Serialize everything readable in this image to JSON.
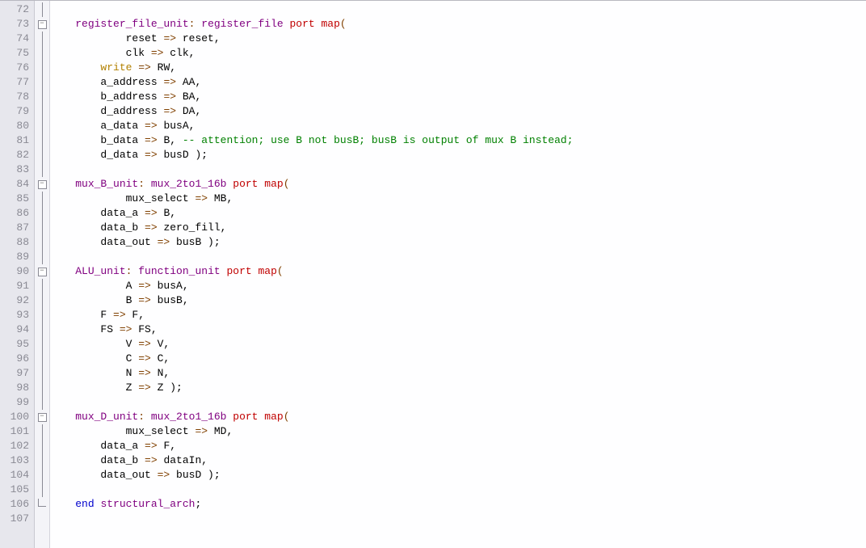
{
  "editor": {
    "first_line_number": 72,
    "lines": [
      {
        "n": 72,
        "fold": "line",
        "tokens": []
      },
      {
        "n": 73,
        "fold": "open",
        "tokens": [
          {
            "c": "t-plain",
            "t": "    "
          },
          {
            "c": "t-label",
            "t": "register_file_unit"
          },
          {
            "c": "t-op",
            "t": ": "
          },
          {
            "c": "t-type",
            "t": "register_file"
          },
          {
            "c": "t-plain",
            "t": " "
          },
          {
            "c": "t-pm",
            "t": "port map"
          },
          {
            "c": "t-op",
            "t": "("
          }
        ]
      },
      {
        "n": 74,
        "fold": "line",
        "tokens": [
          {
            "c": "t-plain",
            "t": "            reset "
          },
          {
            "c": "t-op",
            "t": "=>"
          },
          {
            "c": "t-plain",
            "t": " reset,"
          }
        ]
      },
      {
        "n": 75,
        "fold": "line",
        "tokens": [
          {
            "c": "t-plain",
            "t": "            clk "
          },
          {
            "c": "t-op",
            "t": "=>"
          },
          {
            "c": "t-plain",
            "t": " clk,"
          }
        ]
      },
      {
        "n": 76,
        "fold": "line",
        "tokens": [
          {
            "c": "t-plain",
            "t": "        "
          },
          {
            "c": "t-reskw",
            "t": "write"
          },
          {
            "c": "t-plain",
            "t": " "
          },
          {
            "c": "t-op",
            "t": "=>"
          },
          {
            "c": "t-plain",
            "t": " RW,"
          }
        ]
      },
      {
        "n": 77,
        "fold": "line",
        "tokens": [
          {
            "c": "t-plain",
            "t": "        a_address "
          },
          {
            "c": "t-op",
            "t": "=>"
          },
          {
            "c": "t-plain",
            "t": " AA,"
          }
        ]
      },
      {
        "n": 78,
        "fold": "line",
        "tokens": [
          {
            "c": "t-plain",
            "t": "        b_address "
          },
          {
            "c": "t-op",
            "t": "=>"
          },
          {
            "c": "t-plain",
            "t": " BA,"
          }
        ]
      },
      {
        "n": 79,
        "fold": "line",
        "tokens": [
          {
            "c": "t-plain",
            "t": "        d_address "
          },
          {
            "c": "t-op",
            "t": "=>"
          },
          {
            "c": "t-plain",
            "t": " DA,"
          }
        ]
      },
      {
        "n": 80,
        "fold": "line",
        "tokens": [
          {
            "c": "t-plain",
            "t": "        a_data "
          },
          {
            "c": "t-op",
            "t": "=>"
          },
          {
            "c": "t-plain",
            "t": " busA,"
          }
        ]
      },
      {
        "n": 81,
        "fold": "line",
        "tokens": [
          {
            "c": "t-plain",
            "t": "        b_data "
          },
          {
            "c": "t-op",
            "t": "=>"
          },
          {
            "c": "t-plain",
            "t": " B, "
          },
          {
            "c": "t-cmt",
            "t": "-- attention; use B not busB; busB is output of mux B instead;"
          }
        ]
      },
      {
        "n": 82,
        "fold": "line",
        "tokens": [
          {
            "c": "t-plain",
            "t": "        d_data "
          },
          {
            "c": "t-op",
            "t": "=>"
          },
          {
            "c": "t-plain",
            "t": " busD );"
          }
        ]
      },
      {
        "n": 83,
        "fold": "line",
        "tokens": []
      },
      {
        "n": 84,
        "fold": "open",
        "tokens": [
          {
            "c": "t-plain",
            "t": "    "
          },
          {
            "c": "t-label",
            "t": "mux_B_unit"
          },
          {
            "c": "t-op",
            "t": ": "
          },
          {
            "c": "t-type",
            "t": "mux_2to1_16b"
          },
          {
            "c": "t-plain",
            "t": " "
          },
          {
            "c": "t-pm",
            "t": "port map"
          },
          {
            "c": "t-op",
            "t": "("
          }
        ]
      },
      {
        "n": 85,
        "fold": "line",
        "tokens": [
          {
            "c": "t-plain",
            "t": "            mux_select "
          },
          {
            "c": "t-op",
            "t": "=>"
          },
          {
            "c": "t-plain",
            "t": " MB,"
          }
        ]
      },
      {
        "n": 86,
        "fold": "line",
        "tokens": [
          {
            "c": "t-plain",
            "t": "        data_a "
          },
          {
            "c": "t-op",
            "t": "=>"
          },
          {
            "c": "t-plain",
            "t": " B,"
          }
        ]
      },
      {
        "n": 87,
        "fold": "line",
        "tokens": [
          {
            "c": "t-plain",
            "t": "        data_b "
          },
          {
            "c": "t-op",
            "t": "=>"
          },
          {
            "c": "t-plain",
            "t": " zero_fill,"
          }
        ]
      },
      {
        "n": 88,
        "fold": "line",
        "tokens": [
          {
            "c": "t-plain",
            "t": "        data_out "
          },
          {
            "c": "t-op",
            "t": "=>"
          },
          {
            "c": "t-plain",
            "t": " busB );"
          }
        ]
      },
      {
        "n": 89,
        "fold": "line",
        "tokens": []
      },
      {
        "n": 90,
        "fold": "open",
        "tokens": [
          {
            "c": "t-plain",
            "t": "    "
          },
          {
            "c": "t-label",
            "t": "ALU_unit"
          },
          {
            "c": "t-op",
            "t": ": "
          },
          {
            "c": "t-type",
            "t": "function_unit"
          },
          {
            "c": "t-plain",
            "t": " "
          },
          {
            "c": "t-pm",
            "t": "port map"
          },
          {
            "c": "t-op",
            "t": "("
          }
        ]
      },
      {
        "n": 91,
        "fold": "line",
        "tokens": [
          {
            "c": "t-plain",
            "t": "            A "
          },
          {
            "c": "t-op",
            "t": "=>"
          },
          {
            "c": "t-plain",
            "t": " busA,"
          }
        ]
      },
      {
        "n": 92,
        "fold": "line",
        "tokens": [
          {
            "c": "t-plain",
            "t": "            B "
          },
          {
            "c": "t-op",
            "t": "=>"
          },
          {
            "c": "t-plain",
            "t": " busB,"
          }
        ]
      },
      {
        "n": 93,
        "fold": "line",
        "tokens": [
          {
            "c": "t-plain",
            "t": "        F "
          },
          {
            "c": "t-op",
            "t": "=>"
          },
          {
            "c": "t-plain",
            "t": " F,"
          }
        ]
      },
      {
        "n": 94,
        "fold": "line",
        "tokens": [
          {
            "c": "t-plain",
            "t": "        FS "
          },
          {
            "c": "t-op",
            "t": "=>"
          },
          {
            "c": "t-plain",
            "t": " FS,"
          }
        ]
      },
      {
        "n": 95,
        "fold": "line",
        "tokens": [
          {
            "c": "t-plain",
            "t": "            V "
          },
          {
            "c": "t-op",
            "t": "=>"
          },
          {
            "c": "t-plain",
            "t": " V,"
          }
        ]
      },
      {
        "n": 96,
        "fold": "line",
        "tokens": [
          {
            "c": "t-plain",
            "t": "            C "
          },
          {
            "c": "t-op",
            "t": "=>"
          },
          {
            "c": "t-plain",
            "t": " C,"
          }
        ]
      },
      {
        "n": 97,
        "fold": "line",
        "tokens": [
          {
            "c": "t-plain",
            "t": "            N "
          },
          {
            "c": "t-op",
            "t": "=>"
          },
          {
            "c": "t-plain",
            "t": " N,"
          }
        ]
      },
      {
        "n": 98,
        "fold": "line",
        "tokens": [
          {
            "c": "t-plain",
            "t": "            Z "
          },
          {
            "c": "t-op",
            "t": "=>"
          },
          {
            "c": "t-plain",
            "t": " Z );"
          }
        ]
      },
      {
        "n": 99,
        "fold": "line",
        "tokens": []
      },
      {
        "n": 100,
        "fold": "open",
        "tokens": [
          {
            "c": "t-plain",
            "t": "    "
          },
          {
            "c": "t-label",
            "t": "mux_D_unit"
          },
          {
            "c": "t-op",
            "t": ": "
          },
          {
            "c": "t-type",
            "t": "mux_2to1_16b"
          },
          {
            "c": "t-plain",
            "t": " "
          },
          {
            "c": "t-pm",
            "t": "port map"
          },
          {
            "c": "t-op",
            "t": "("
          }
        ]
      },
      {
        "n": 101,
        "fold": "line",
        "tokens": [
          {
            "c": "t-plain",
            "t": "            mux_select "
          },
          {
            "c": "t-op",
            "t": "=>"
          },
          {
            "c": "t-plain",
            "t": " MD,"
          }
        ]
      },
      {
        "n": 102,
        "fold": "line",
        "tokens": [
          {
            "c": "t-plain",
            "t": "        data_a "
          },
          {
            "c": "t-op",
            "t": "=>"
          },
          {
            "c": "t-plain",
            "t": " F,"
          }
        ]
      },
      {
        "n": 103,
        "fold": "line",
        "tokens": [
          {
            "c": "t-plain",
            "t": "        data_b "
          },
          {
            "c": "t-op",
            "t": "=>"
          },
          {
            "c": "t-plain",
            "t": " dataIn,"
          }
        ]
      },
      {
        "n": 104,
        "fold": "line",
        "tokens": [
          {
            "c": "t-plain",
            "t": "        data_out "
          },
          {
            "c": "t-op",
            "t": "=>"
          },
          {
            "c": "t-plain",
            "t": " busD );"
          }
        ]
      },
      {
        "n": 105,
        "fold": "line",
        "tokens": []
      },
      {
        "n": 106,
        "fold": "end",
        "tokens": [
          {
            "c": "t-plain",
            "t": "    "
          },
          {
            "c": "t-kw",
            "t": "end"
          },
          {
            "c": "t-plain",
            "t": " "
          },
          {
            "c": "t-type",
            "t": "structural_arch"
          },
          {
            "c": "t-plain",
            "t": ";"
          }
        ]
      },
      {
        "n": 107,
        "fold": "none",
        "tokens": []
      }
    ]
  }
}
